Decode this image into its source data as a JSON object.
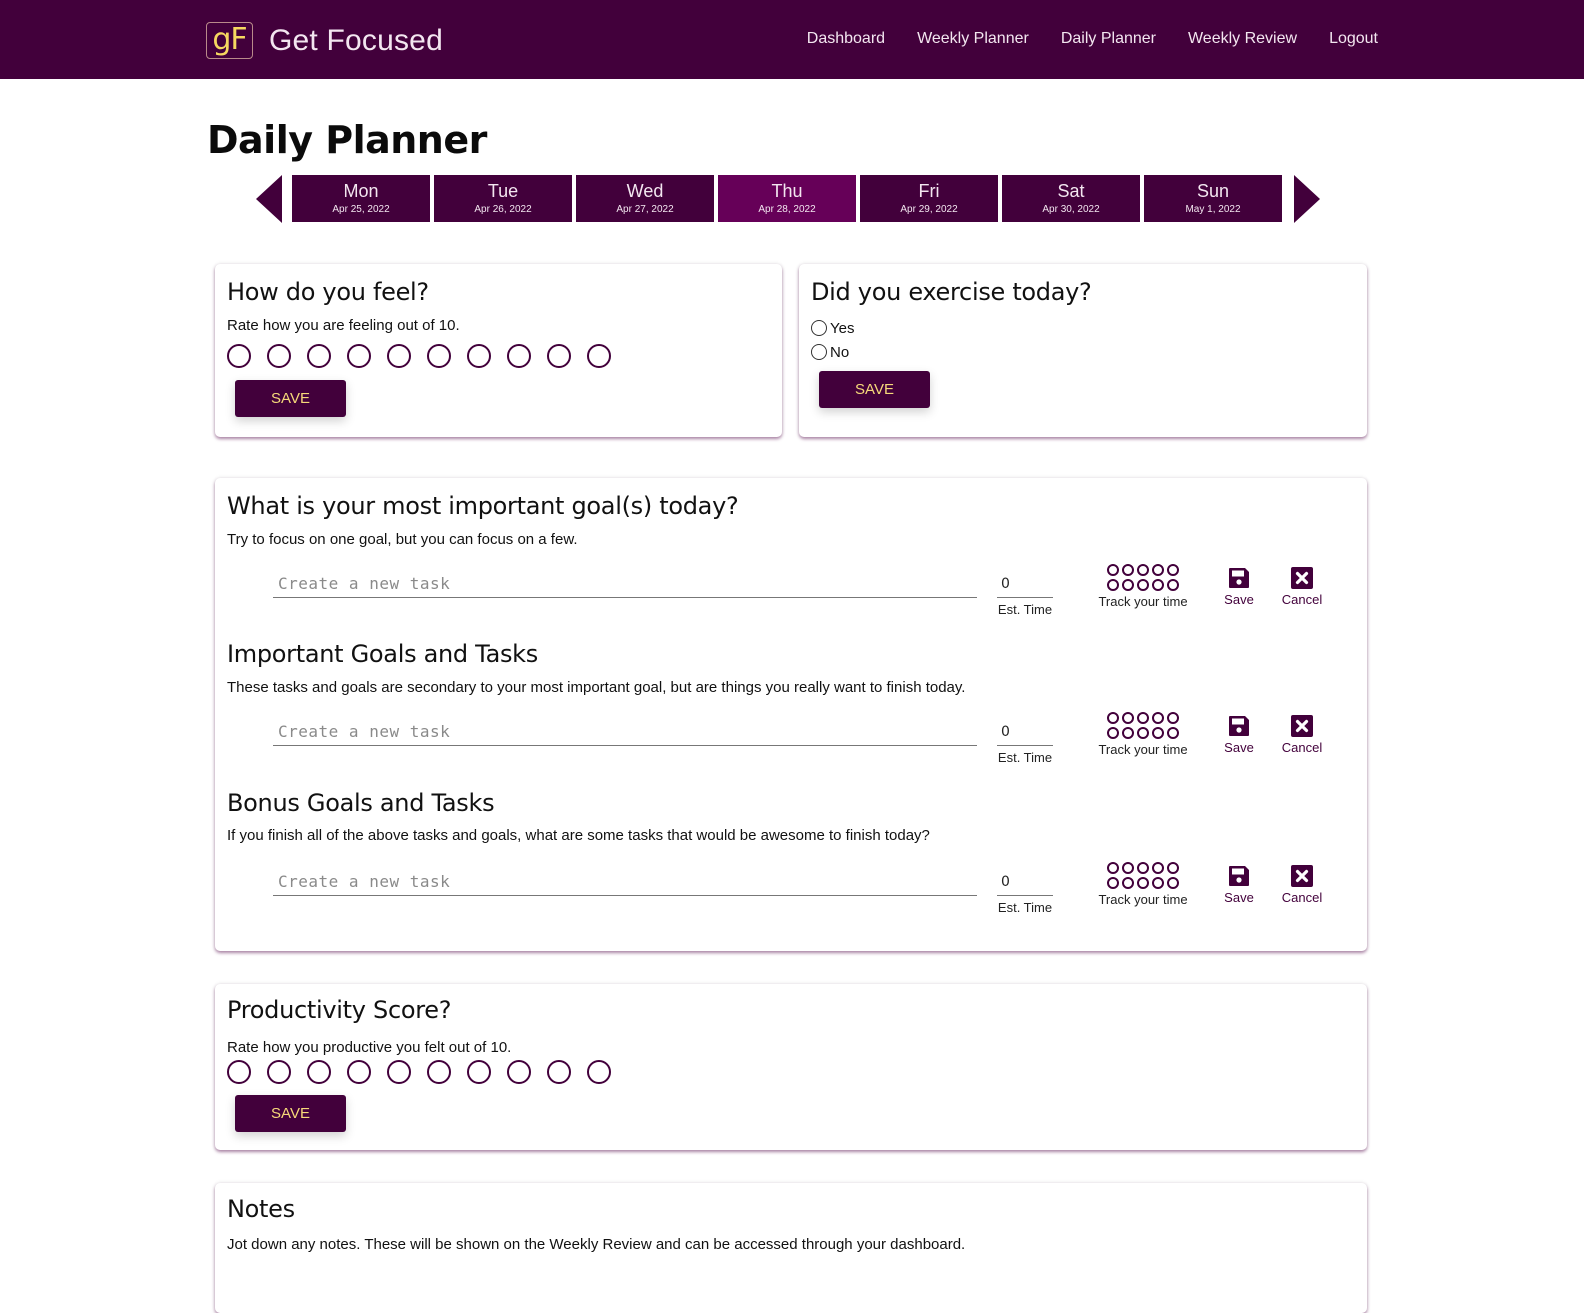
{
  "nav": {
    "logo": "gF",
    "brand": "Get Focused",
    "links": [
      "Dashboard",
      "Weekly Planner",
      "Daily Planner",
      "Weekly Review",
      "Logout"
    ]
  },
  "page": {
    "title": "Daily Planner"
  },
  "days": {
    "prev_icon": "triangle-left-icon",
    "next_icon": "triangle-right-icon",
    "active_index": 3,
    "items": [
      {
        "name": "Mon",
        "date": "Apr 25, 2022"
      },
      {
        "name": "Tue",
        "date": "Apr 26, 2022"
      },
      {
        "name": "Wed",
        "date": "Apr 27, 2022"
      },
      {
        "name": "Thu",
        "date": "Apr 28, 2022"
      },
      {
        "name": "Fri",
        "date": "Apr 29, 2022"
      },
      {
        "name": "Sat",
        "date": "Apr 30, 2022"
      },
      {
        "name": "Sun",
        "date": "May 1, 2022"
      }
    ]
  },
  "feel": {
    "title": "How do you feel?",
    "desc": "Rate how you are feeling out of 10.",
    "scale": 10,
    "save_label": "SAVE"
  },
  "exercise": {
    "title": "Did you exercise today?",
    "options": [
      "Yes",
      "No"
    ],
    "save_label": "SAVE"
  },
  "goals": {
    "sections": [
      {
        "title": "What is your most important goal(s) today?",
        "desc": "Try to focus on one goal, but you can focus on a few.",
        "placeholder": "Create a new task",
        "est_value": "0",
        "est_label": "Est. Time",
        "track_label": "Track your time",
        "save_label": "Save",
        "cancel_label": "Cancel"
      },
      {
        "title": "Important Goals and Tasks",
        "desc": "These tasks and goals are secondary to your most important goal, but are things you really want to finish today.",
        "placeholder": "Create a new task",
        "est_value": "0",
        "est_label": "Est. Time",
        "track_label": "Track your time",
        "save_label": "Save",
        "cancel_label": "Cancel"
      },
      {
        "title": "Bonus Goals and Tasks",
        "desc": "If you finish all of the above tasks and goals, what are some tasks that would be awesome to finish today?",
        "placeholder": "Create a new task",
        "est_value": "0",
        "est_label": "Est. Time",
        "track_label": "Track your time",
        "save_label": "Save",
        "cancel_label": "Cancel"
      }
    ]
  },
  "productivity": {
    "title": "Productivity Score?",
    "desc": "Rate how you productive you felt out of 10.",
    "scale": 10,
    "save_label": "SAVE"
  },
  "notes": {
    "title": "Notes",
    "desc": "Jot down any notes. These will be shown on the Weekly Review and can be accessed through your dashboard."
  },
  "colors": {
    "primary": "#42003b",
    "active_day": "#660058",
    "button_text": "#f6d97a",
    "logo_text": "#f6d860"
  }
}
